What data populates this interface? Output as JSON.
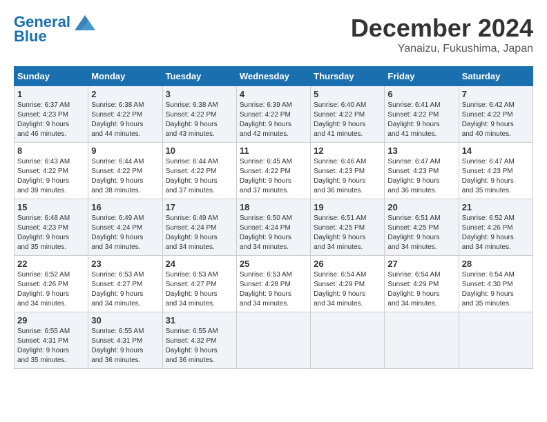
{
  "header": {
    "logo_line1": "General",
    "logo_line2": "Blue",
    "month": "December 2024",
    "location": "Yanaizu, Fukushima, Japan"
  },
  "weekdays": [
    "Sunday",
    "Monday",
    "Tuesday",
    "Wednesday",
    "Thursday",
    "Friday",
    "Saturday"
  ],
  "weeks": [
    [
      {
        "day": "1",
        "sunrise": "6:37 AM",
        "sunset": "4:23 PM",
        "daylight": "9 hours and 46 minutes."
      },
      {
        "day": "2",
        "sunrise": "6:38 AM",
        "sunset": "4:22 PM",
        "daylight": "9 hours and 44 minutes."
      },
      {
        "day": "3",
        "sunrise": "6:38 AM",
        "sunset": "4:22 PM",
        "daylight": "9 hours and 43 minutes."
      },
      {
        "day": "4",
        "sunrise": "6:39 AM",
        "sunset": "4:22 PM",
        "daylight": "9 hours and 42 minutes."
      },
      {
        "day": "5",
        "sunrise": "6:40 AM",
        "sunset": "4:22 PM",
        "daylight": "9 hours and 41 minutes."
      },
      {
        "day": "6",
        "sunrise": "6:41 AM",
        "sunset": "4:22 PM",
        "daylight": "9 hours and 41 minutes."
      },
      {
        "day": "7",
        "sunrise": "6:42 AM",
        "sunset": "4:22 PM",
        "daylight": "9 hours and 40 minutes."
      }
    ],
    [
      {
        "day": "8",
        "sunrise": "6:43 AM",
        "sunset": "4:22 PM",
        "daylight": "9 hours and 39 minutes."
      },
      {
        "day": "9",
        "sunrise": "6:44 AM",
        "sunset": "4:22 PM",
        "daylight": "9 hours and 38 minutes."
      },
      {
        "day": "10",
        "sunrise": "6:44 AM",
        "sunset": "4:22 PM",
        "daylight": "9 hours and 37 minutes."
      },
      {
        "day": "11",
        "sunrise": "6:45 AM",
        "sunset": "4:22 PM",
        "daylight": "9 hours and 37 minutes."
      },
      {
        "day": "12",
        "sunrise": "6:46 AM",
        "sunset": "4:23 PM",
        "daylight": "9 hours and 36 minutes."
      },
      {
        "day": "13",
        "sunrise": "6:47 AM",
        "sunset": "4:23 PM",
        "daylight": "9 hours and 36 minutes."
      },
      {
        "day": "14",
        "sunrise": "6:47 AM",
        "sunset": "4:23 PM",
        "daylight": "9 hours and 35 minutes."
      }
    ],
    [
      {
        "day": "15",
        "sunrise": "6:48 AM",
        "sunset": "4:23 PM",
        "daylight": "9 hours and 35 minutes."
      },
      {
        "day": "16",
        "sunrise": "6:49 AM",
        "sunset": "4:24 PM",
        "daylight": "9 hours and 34 minutes."
      },
      {
        "day": "17",
        "sunrise": "6:49 AM",
        "sunset": "4:24 PM",
        "daylight": "9 hours and 34 minutes."
      },
      {
        "day": "18",
        "sunrise": "6:50 AM",
        "sunset": "4:24 PM",
        "daylight": "9 hours and 34 minutes."
      },
      {
        "day": "19",
        "sunrise": "6:51 AM",
        "sunset": "4:25 PM",
        "daylight": "9 hours and 34 minutes."
      },
      {
        "day": "20",
        "sunrise": "6:51 AM",
        "sunset": "4:25 PM",
        "daylight": "9 hours and 34 minutes."
      },
      {
        "day": "21",
        "sunrise": "6:52 AM",
        "sunset": "4:26 PM",
        "daylight": "9 hours and 34 minutes."
      }
    ],
    [
      {
        "day": "22",
        "sunrise": "6:52 AM",
        "sunset": "4:26 PM",
        "daylight": "9 hours and 34 minutes."
      },
      {
        "day": "23",
        "sunrise": "6:53 AM",
        "sunset": "4:27 PM",
        "daylight": "9 hours and 34 minutes."
      },
      {
        "day": "24",
        "sunrise": "6:53 AM",
        "sunset": "4:27 PM",
        "daylight": "9 hours and 34 minutes."
      },
      {
        "day": "25",
        "sunrise": "6:53 AM",
        "sunset": "4:28 PM",
        "daylight": "9 hours and 34 minutes."
      },
      {
        "day": "26",
        "sunrise": "6:54 AM",
        "sunset": "4:29 PM",
        "daylight": "9 hours and 34 minutes."
      },
      {
        "day": "27",
        "sunrise": "6:54 AM",
        "sunset": "4:29 PM",
        "daylight": "9 hours and 34 minutes."
      },
      {
        "day": "28",
        "sunrise": "6:54 AM",
        "sunset": "4:30 PM",
        "daylight": "9 hours and 35 minutes."
      }
    ],
    [
      {
        "day": "29",
        "sunrise": "6:55 AM",
        "sunset": "4:31 PM",
        "daylight": "9 hours and 35 minutes."
      },
      {
        "day": "30",
        "sunrise": "6:55 AM",
        "sunset": "4:31 PM",
        "daylight": "9 hours and 36 minutes."
      },
      {
        "day": "31",
        "sunrise": "6:55 AM",
        "sunset": "4:32 PM",
        "daylight": "9 hours and 36 minutes."
      },
      null,
      null,
      null,
      null
    ]
  ]
}
